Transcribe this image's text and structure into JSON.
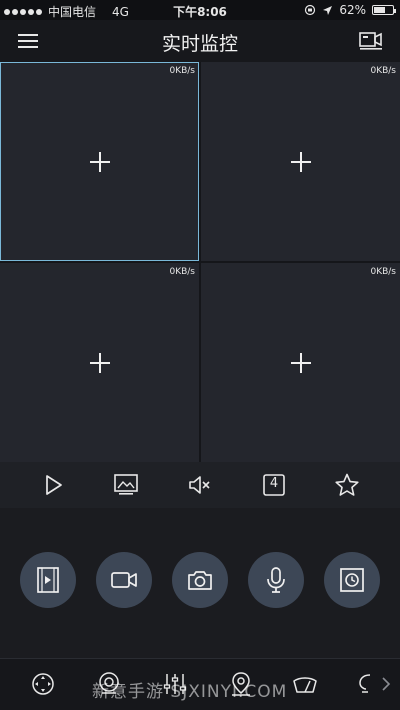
{
  "status_bar": {
    "carrier": "中国电信",
    "network": "4G",
    "time": "下午8:06",
    "battery": "62%",
    "battery_level": 0.62
  },
  "header": {
    "title": "实时监控",
    "menu_icon": "hamburger-menu-icon",
    "device_icon": "camera-list-icon"
  },
  "grid": {
    "cells": [
      {
        "rate": "0KB/s",
        "selected": true
      },
      {
        "rate": "0KB/s",
        "selected": false
      },
      {
        "rate": "0KB/s",
        "selected": false
      },
      {
        "rate": "0KB/s",
        "selected": false
      }
    ]
  },
  "controls": [
    "play-icon",
    "image-quality-icon",
    "mute-icon",
    "split-4-icon",
    "favorite-star-icon"
  ],
  "controls_split_label": "4",
  "actions": [
    "video-playback-icon",
    "record-icon",
    "snapshot-icon",
    "microphone-icon",
    "timed-playback-icon"
  ],
  "bottom_tools": [
    "ptz-direction-icon",
    "zoom-icon",
    "adjust-icon",
    "preset-icon",
    "wiper-icon"
  ],
  "watermark": "新意手游 SJXINYI.COM",
  "colors": {
    "background": "#1c1e23",
    "cell": "#24262d",
    "selected_border": "#7ab8d8",
    "action_button": "#3d4756"
  }
}
